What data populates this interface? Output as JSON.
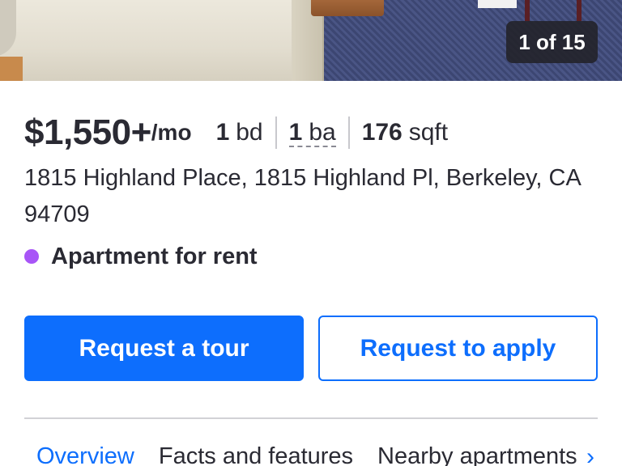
{
  "photo": {
    "counter": "1 of 15"
  },
  "listing": {
    "price": "$1,550+",
    "price_suffix": "/mo",
    "beds_value": "1",
    "beds_unit": "bd",
    "baths_value": "1",
    "baths_unit": "ba",
    "sqft_value": "176",
    "sqft_unit": "sqft",
    "address": "1815 Highland Place, 1815 Highland Pl, Berkeley, CA 94709",
    "type": "Apartment for rent",
    "type_dot_color": "#a855f7"
  },
  "actions": {
    "tour_label": "Request a tour",
    "apply_label": "Request to apply",
    "accent_color": "#0d6efd"
  },
  "tabs": [
    {
      "label": "Overview",
      "active": true
    },
    {
      "label": "Facts and features",
      "active": false
    },
    {
      "label": "Nearby apartments",
      "active": false
    }
  ],
  "icons": {
    "tabs_scroll": "chevron-right-icon"
  }
}
